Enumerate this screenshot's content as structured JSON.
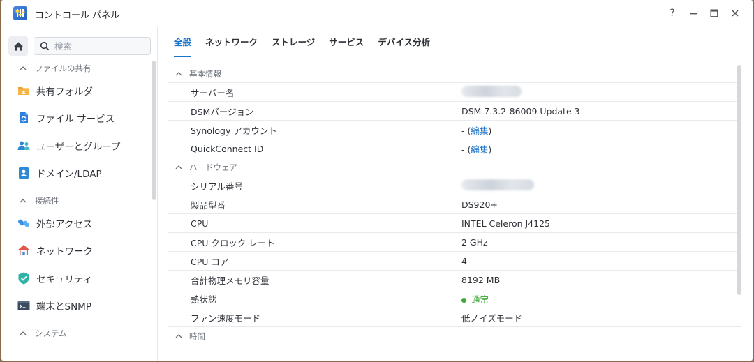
{
  "window": {
    "title": "コントロール パネル",
    "buttons": {
      "help": "?",
      "minimize": "—",
      "maximize": "□",
      "close": "✕"
    }
  },
  "sidebar": {
    "search_placeholder": "検索",
    "sections": [
      {
        "heading": "ファイルの共有",
        "items": [
          {
            "label": "共有フォルダ",
            "icon": "shared-folder-icon"
          },
          {
            "label": "ファイル サービス",
            "icon": "file-services-icon"
          },
          {
            "label": "ユーザーとグループ",
            "icon": "users-groups-icon"
          },
          {
            "label": "ドメイン/LDAP",
            "icon": "domain-ldap-icon"
          }
        ]
      },
      {
        "heading": "接続性",
        "items": [
          {
            "label": "外部アクセス",
            "icon": "external-access-icon"
          },
          {
            "label": "ネットワーク",
            "icon": "network-icon"
          },
          {
            "label": "セキュリティ",
            "icon": "security-icon"
          },
          {
            "label": "端末とSNMP",
            "icon": "terminal-snmp-icon"
          }
        ]
      },
      {
        "heading": "システム",
        "items": []
      }
    ]
  },
  "tabs": [
    {
      "label": "全般",
      "active": true
    },
    {
      "label": "ネットワーク",
      "active": false
    },
    {
      "label": "ストレージ",
      "active": false
    },
    {
      "label": "サービス",
      "active": false
    },
    {
      "label": "デバイス分析",
      "active": false
    }
  ],
  "info": {
    "basic": {
      "heading": "基本情報",
      "server_name_label": "サーバー名",
      "dsm_label": "DSMバージョン",
      "dsm_value": "DSM 7.3.2-86009 Update 3",
      "synology_label": "Synology アカウント",
      "synology_value_prefix": "- (",
      "synology_link": "編集",
      "synology_value_suffix": ")",
      "qc_label": "QuickConnect ID",
      "qc_value_prefix": "- (",
      "qc_link": "編集",
      "qc_value_suffix": ")"
    },
    "hardware": {
      "heading": "ハードウェア",
      "serial_label": "シリアル番号",
      "model_label": "製品型番",
      "model_value": "DS920+",
      "cpu_label": "CPU",
      "cpu_value": "INTEL Celeron J4125",
      "clock_label": "CPU クロック レート",
      "clock_value": "2 GHz",
      "cores_label": "CPU コア",
      "cores_value": "4",
      "memory_label": "合計物理メモリ容量",
      "memory_value": "8192 MB",
      "thermal_label": "熱状態",
      "thermal_value": "通常",
      "fan_label": "ファン速度モード",
      "fan_value": "低ノイズモード"
    },
    "time": {
      "heading": "時間"
    }
  },
  "colors": {
    "accent": "#1a73c9",
    "status_normal": "#3aa832"
  }
}
